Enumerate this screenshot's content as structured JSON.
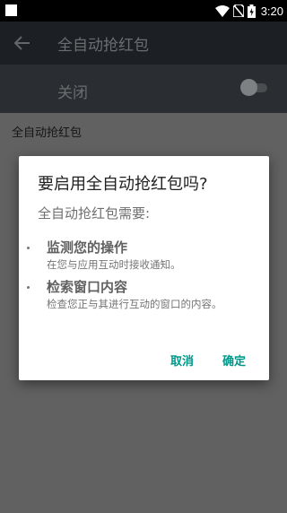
{
  "status_bar": {
    "time": "3:20"
  },
  "app_bar": {
    "title": "全自动抢红包"
  },
  "toggle_row": {
    "label": "关闭",
    "enabled": false
  },
  "section": {
    "title": "全自动抢红包"
  },
  "dialog": {
    "title": "要启用全自动抢红包吗?",
    "subtitle": "全自动抢红包需要:",
    "permissions": [
      {
        "heading": "监测您的操作",
        "description": "在您与应用互动时接收通知。"
      },
      {
        "heading": "检索窗口内容",
        "description": "检查您正与其进行互动的窗口的内容。"
      }
    ],
    "cancel_label": "取消",
    "confirm_label": "确定"
  },
  "colors": {
    "accent": "#009688",
    "scrim": "#616161",
    "dialog_bg": "#ffffff"
  }
}
